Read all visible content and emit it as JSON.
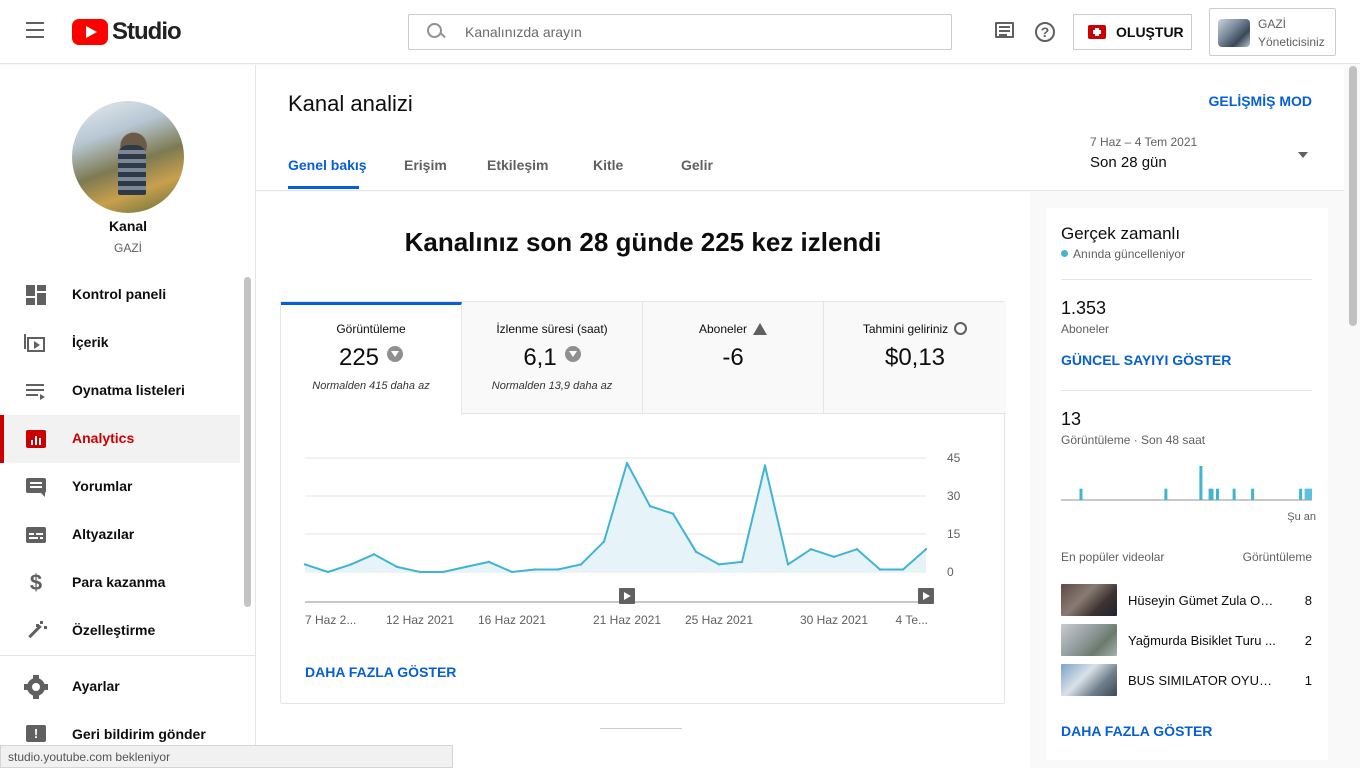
{
  "header": {
    "logo_text": "Studio",
    "search_placeholder": "Kanalınızda arayın",
    "create_label": "OLUŞTUR",
    "account_name": "GAZİ",
    "account_role": "Yöneticisiniz"
  },
  "sidebar": {
    "channel_title": "Kanal",
    "channel_name": "GAZİ",
    "items": [
      {
        "label": "Kontrol paneli",
        "icon": "dashboard-icon"
      },
      {
        "label": "İçerik",
        "icon": "content-icon"
      },
      {
        "label": "Oynatma listeleri",
        "icon": "playlist-icon"
      },
      {
        "label": "Analytics",
        "icon": "analytics-icon",
        "active": true
      },
      {
        "label": "Yorumlar",
        "icon": "comments-icon"
      },
      {
        "label": "Altyazılar",
        "icon": "subtitles-icon"
      },
      {
        "label": "Para kazanma",
        "icon": "dollar-icon"
      },
      {
        "label": "Özelleştirme",
        "icon": "magic-wand-icon"
      }
    ],
    "bottom_items": [
      {
        "label": "Ayarlar",
        "icon": "gear-icon"
      },
      {
        "label": "Geri bildirim gönder",
        "icon": "feedback-icon"
      }
    ]
  },
  "page": {
    "title": "Kanal analizi",
    "advanced_mode": "GELİŞMİŞ MOD",
    "tabs": [
      "Genel bakış",
      "Erişim",
      "Etkileşim",
      "Kitle",
      "Gelir"
    ],
    "active_tab": "Genel bakış",
    "date_range": "7 Haz – 4 Tem 2021",
    "date_label": "Son 28 gün"
  },
  "overview": {
    "headline": "Kanalınız son 28 günde 225 kez izlendi",
    "metrics": [
      {
        "title": "Görüntüleme",
        "value": "225",
        "sub": "Normalden 415 daha az",
        "badge": "down"
      },
      {
        "title": "İzlenme süresi (saat)",
        "value": "6,1",
        "sub": "Normalden 13,9 daha az",
        "badge": "down"
      },
      {
        "title": "Aboneler",
        "value": "-6",
        "sub": "",
        "badge": "warning"
      },
      {
        "title": "Tahmini geliriniz",
        "value": "$0,13",
        "sub": "",
        "badge": "clock"
      }
    ],
    "show_more": "DAHA FAZLA GÖSTER"
  },
  "chart_data": {
    "type": "area",
    "x": [
      "7 Haz",
      "8 Haz",
      "9 Haz",
      "10 Haz",
      "11 Haz",
      "12 Haz",
      "13 Haz",
      "14 Haz",
      "15 Haz",
      "16 Haz",
      "17 Haz",
      "18 Haz",
      "19 Haz",
      "20 Haz",
      "21 Haz",
      "22 Haz",
      "23 Haz",
      "24 Haz",
      "25 Haz",
      "26 Haz",
      "27 Haz",
      "28 Haz",
      "29 Haz",
      "30 Haz",
      "1 Tem",
      "2 Tem",
      "3 Tem",
      "4 Tem"
    ],
    "values": [
      3,
      0,
      3,
      7,
      2,
      0,
      0,
      2,
      4,
      0,
      1,
      1,
      3,
      12,
      43,
      26,
      23,
      8,
      3,
      4,
      42,
      3,
      9,
      6,
      9,
      1,
      1,
      9
    ],
    "ylim": [
      0,
      45
    ],
    "yticks": [
      "45",
      "30",
      "15",
      "0"
    ],
    "xtick_labels": [
      "7 Haz 2...",
      "12 Haz 2021",
      "16 Haz 2021",
      "21 Haz 2021",
      "25 Haz 2021",
      "30 Haz 2021",
      "4 Te..."
    ],
    "xtick_index": [
      0,
      5,
      9,
      14,
      18,
      23,
      27
    ],
    "video_marker_index": [
      14,
      27
    ],
    "grid": true,
    "color": "#41b4d2",
    "fill": "#e6f3f8"
  },
  "realtime": {
    "title": "Gerçek zamanlı",
    "live_text": "Anında güncelleniyor",
    "subscribers_value": "1.353",
    "subscribers_label": "Aboneler",
    "subscribers_link": "GÜNCEL SAYIYI GÖSTER",
    "views_value": "13",
    "views_label": "Görüntüleme · Son 48 saat",
    "now_label": "Şu an",
    "hourly_views": [
      0,
      0,
      0,
      0,
      0,
      0,
      0,
      0,
      0,
      0,
      1,
      0,
      0,
      0,
      0,
      0,
      0,
      0,
      0,
      0,
      0,
      0,
      0,
      0,
      0,
      0,
      0,
      0,
      0,
      0,
      0,
      0,
      0,
      0,
      0,
      0,
      0,
      0,
      0,
      0,
      0,
      0,
      0,
      0,
      0,
      0,
      0,
      0,
      0,
      0,
      0,
      0,
      0,
      0,
      0,
      0,
      1,
      0,
      0,
      0,
      0,
      0,
      0,
      0,
      0,
      0,
      0,
      0,
      0,
      0,
      0,
      0,
      0,
      0,
      0,
      3,
      0,
      0,
      0,
      0,
      1,
      1,
      0,
      0,
      1,
      0,
      0,
      0,
      0,
      0,
      0,
      0,
      0,
      1,
      0,
      0,
      0,
      0,
      0,
      0,
      0,
      0,
      0,
      1,
      0,
      0,
      0,
      0,
      0,
      0,
      0,
      0,
      0,
      0,
      0,
      0,
      0,
      0,
      0,
      0,
      0,
      0,
      0,
      0,
      0,
      0,
      0,
      0,
      0,
      1,
      0,
      0,
      1,
      1,
      1,
      1
    ],
    "popular_label": "En popüler videolar",
    "popular_col": "Görüntüleme",
    "videos": [
      {
        "title": "Hüseyin Gümet Zula Oyn...",
        "views": "8"
      },
      {
        "title": "Yağmurda Bisiklet Turu ...",
        "views": "2"
      },
      {
        "title": "BUS SIMILATOR OYUNU...",
        "views": "1"
      }
    ],
    "show_more": "DAHA FAZLA GÖSTER"
  },
  "status_bar": "studio.youtube.com bekleniyor"
}
